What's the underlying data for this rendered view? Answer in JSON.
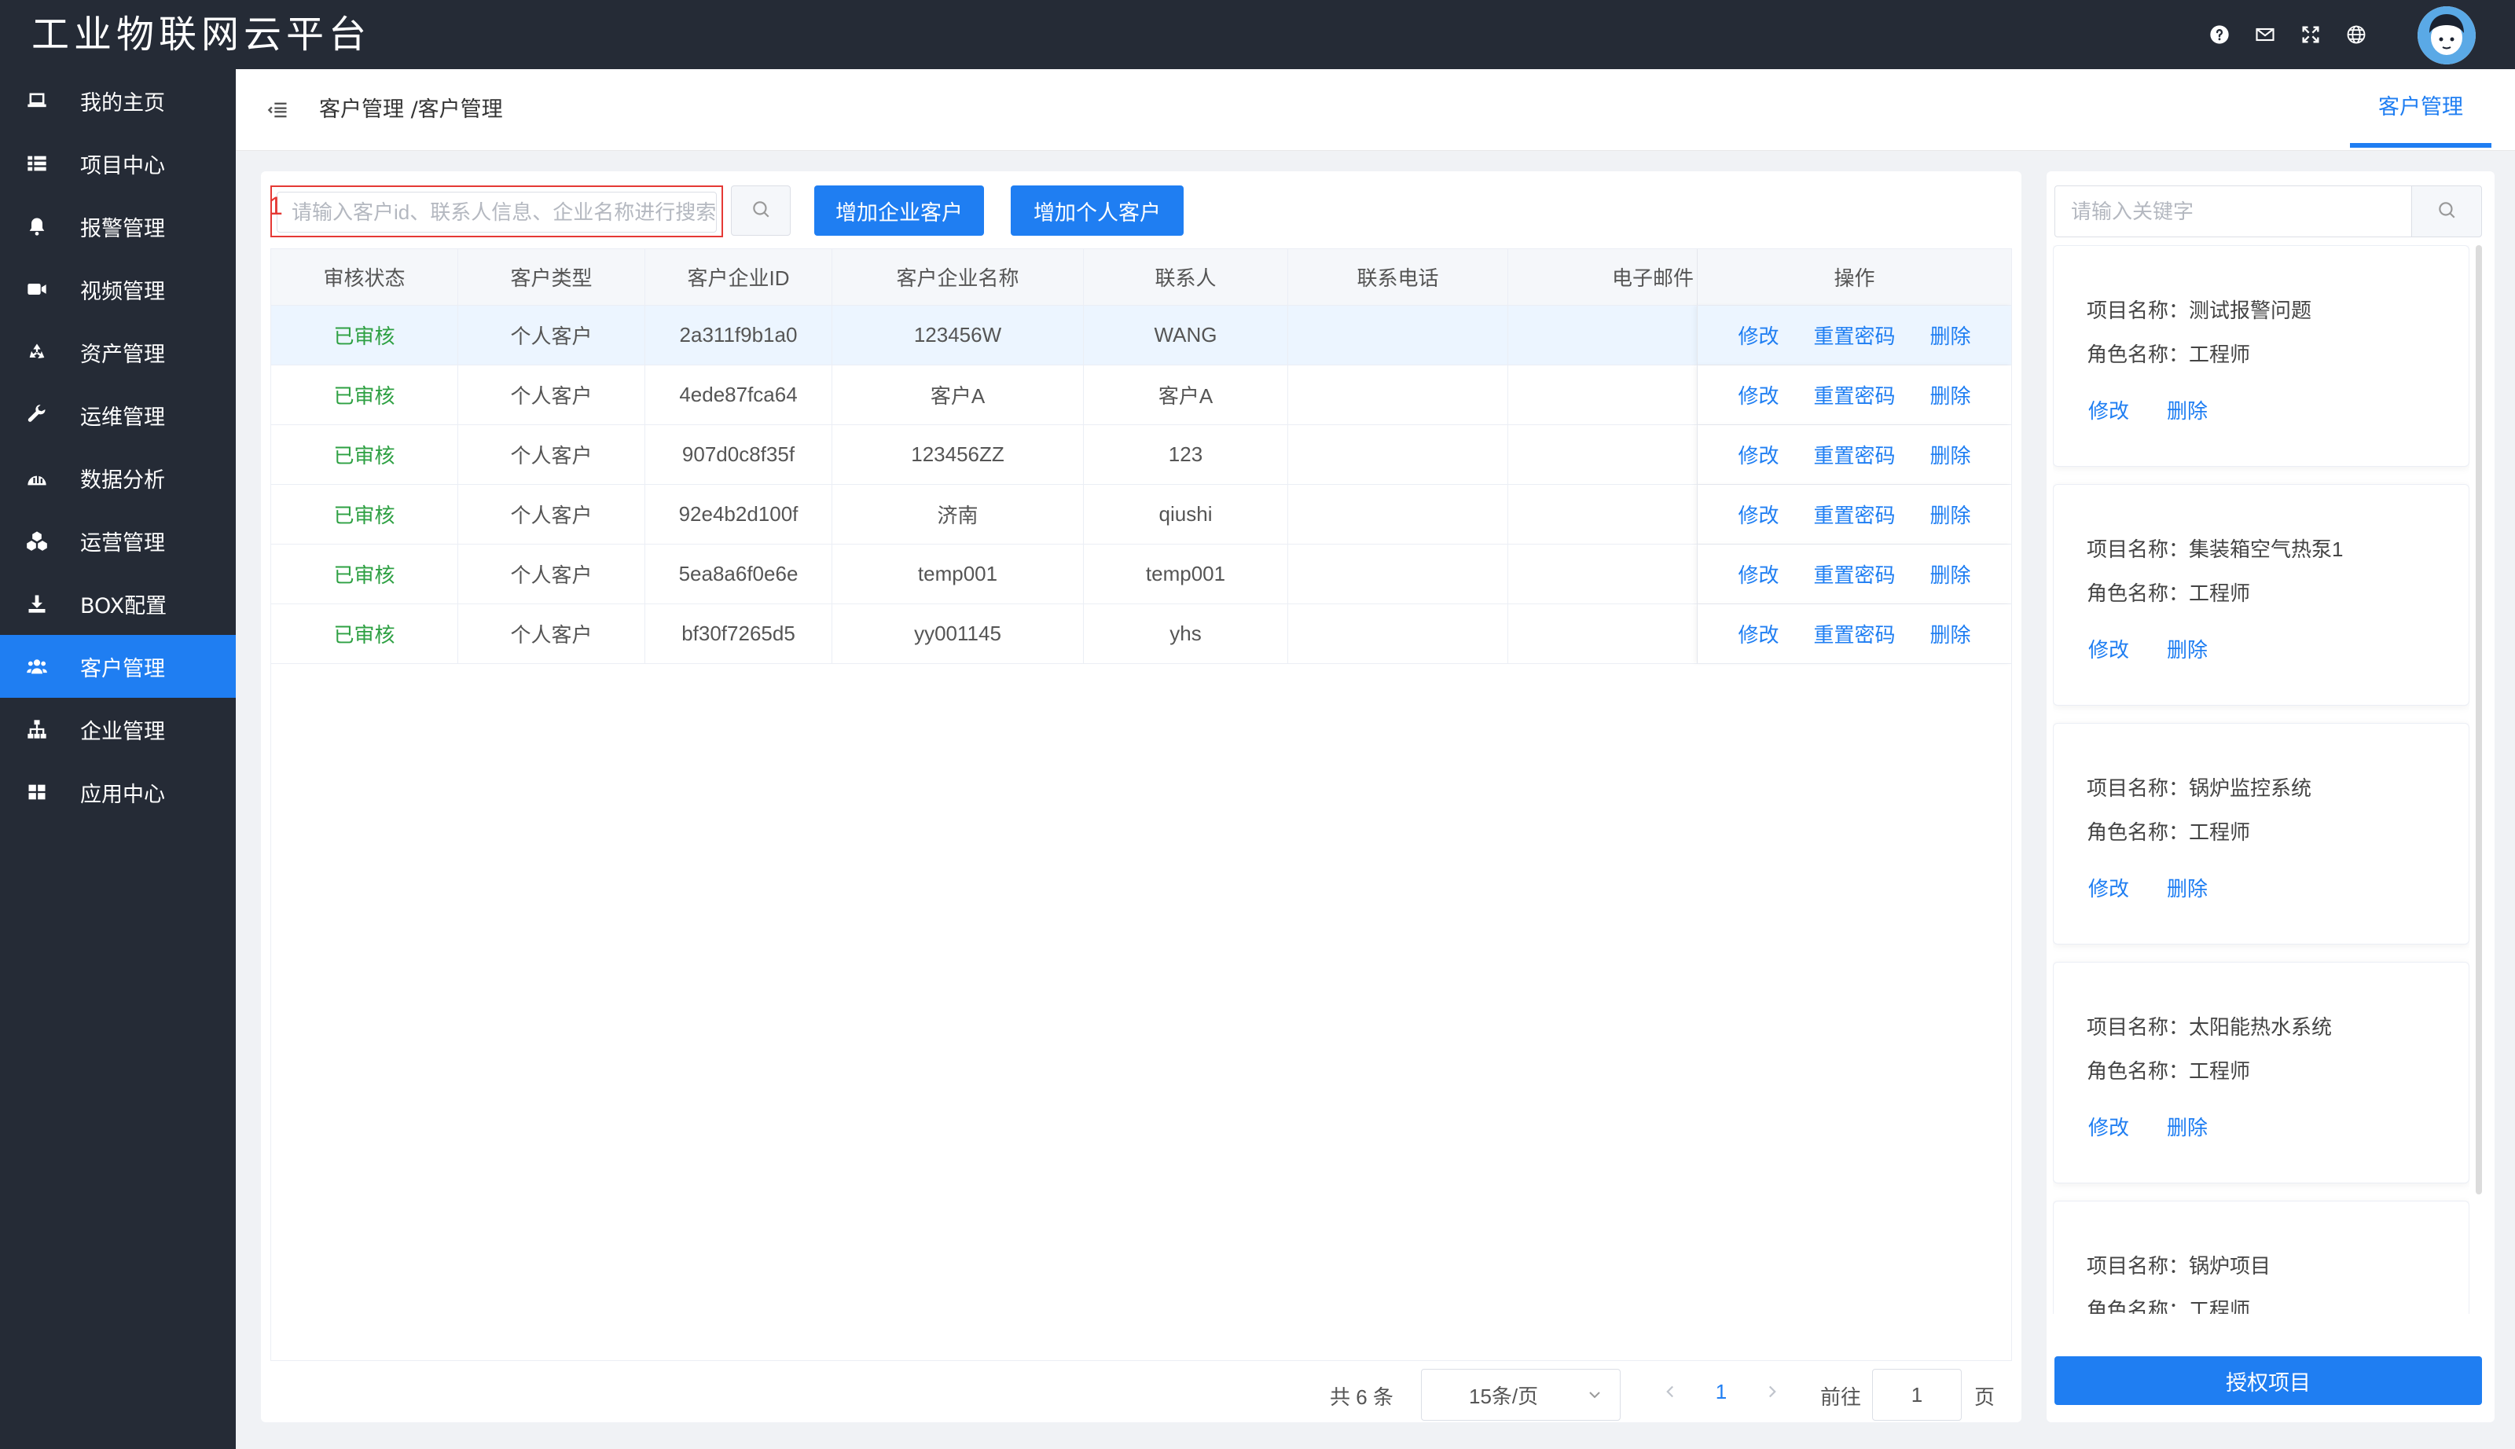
{
  "app": {
    "title": "工业物联网云平台"
  },
  "topbar": {
    "icons": [
      "help-icon",
      "mail-icon",
      "fullscreen-icon",
      "globe-icon"
    ]
  },
  "sidebar": {
    "items": [
      {
        "label": "我的主页",
        "icon": "laptop-icon"
      },
      {
        "label": "项目中心",
        "icon": "list-icon"
      },
      {
        "label": "报警管理",
        "icon": "bell-icon"
      },
      {
        "label": "视频管理",
        "icon": "video-icon"
      },
      {
        "label": "资产管理",
        "icon": "recycle-icon"
      },
      {
        "label": "运维管理",
        "icon": "wrench-icon"
      },
      {
        "label": "数据分析",
        "icon": "chart-icon"
      },
      {
        "label": "运营管理",
        "icon": "cubes-icon"
      },
      {
        "label": "BOX配置",
        "icon": "download-icon"
      },
      {
        "label": "客户管理",
        "icon": "users-icon",
        "active": true
      },
      {
        "label": "企业管理",
        "icon": "sitemap-icon"
      },
      {
        "label": "应用中心",
        "icon": "grid-icon"
      }
    ]
  },
  "header": {
    "breadcrumb": "客户管理 /客户管理",
    "active_tab": "客户管理"
  },
  "toolbar": {
    "search_placeholder": "请输入客户id、联系人信息、企业名称进行搜索",
    "search_marker": "1",
    "add_enterprise_label": "增加企业客户",
    "add_personal_label": "增加个人客户"
  },
  "table": {
    "columns": [
      "审核状态",
      "客户类型",
      "客户企业ID",
      "客户企业名称",
      "联系人",
      "联系电话",
      "电子邮件",
      "操作"
    ],
    "actions": {
      "edit": "修改",
      "reset": "重置密码",
      "delete": "删除"
    },
    "rows": [
      {
        "status": "已审核",
        "type": "个人客户",
        "id": "2a311f9b1a0",
        "name": "123456W",
        "contact": "WANG",
        "phone": "",
        "email": ""
      },
      {
        "status": "已审核",
        "type": "个人客户",
        "id": "4ede87fca64",
        "name": "客户A",
        "contact": "客户A",
        "phone": "",
        "email": ""
      },
      {
        "status": "已审核",
        "type": "个人客户",
        "id": "907d0c8f35f",
        "name": "123456ZZ",
        "contact": "123",
        "phone": "",
        "email": ""
      },
      {
        "status": "已审核",
        "type": "个人客户",
        "id": "92e4b2d100f",
        "name": "济南",
        "contact": "qiushi",
        "phone": "",
        "email": ""
      },
      {
        "status": "已审核",
        "type": "个人客户",
        "id": "5ea8a6f0e6e",
        "name": "temp001",
        "contact": "temp001",
        "phone": "",
        "email": ""
      },
      {
        "status": "已审核",
        "type": "个人客户",
        "id": "bf30f7265d5",
        "name": "yy001145",
        "contact": "yhs",
        "phone": "",
        "email": ""
      }
    ]
  },
  "pagination": {
    "total": "共 6 条",
    "page_size": "15条/页",
    "current_page": "1",
    "goto_label": "前往",
    "goto_value": "1",
    "page_suffix": "页"
  },
  "right_panel": {
    "search_placeholder": "请输入关键字",
    "project_label": "项目名称：",
    "role_label": "角色名称：",
    "edit_label": "修改",
    "delete_label": "删除",
    "projects": [
      {
        "name": "测试报警问题",
        "role": "工程师"
      },
      {
        "name": "集装箱空气热泵1",
        "role": "工程师"
      },
      {
        "name": "锅炉监控系统",
        "role": "工程师"
      },
      {
        "name": "太阳能热水系统",
        "role": "工程师"
      },
      {
        "name": "锅炉项目",
        "role": "工程师"
      }
    ],
    "auth_button": "授权项目"
  },
  "colors": {
    "primary": "#1f7ef2",
    "sidebar_bg": "#252b36",
    "status_green": "#2ea043",
    "highlight_row": "#ecf5ff",
    "annotation_red": "#e53935"
  }
}
